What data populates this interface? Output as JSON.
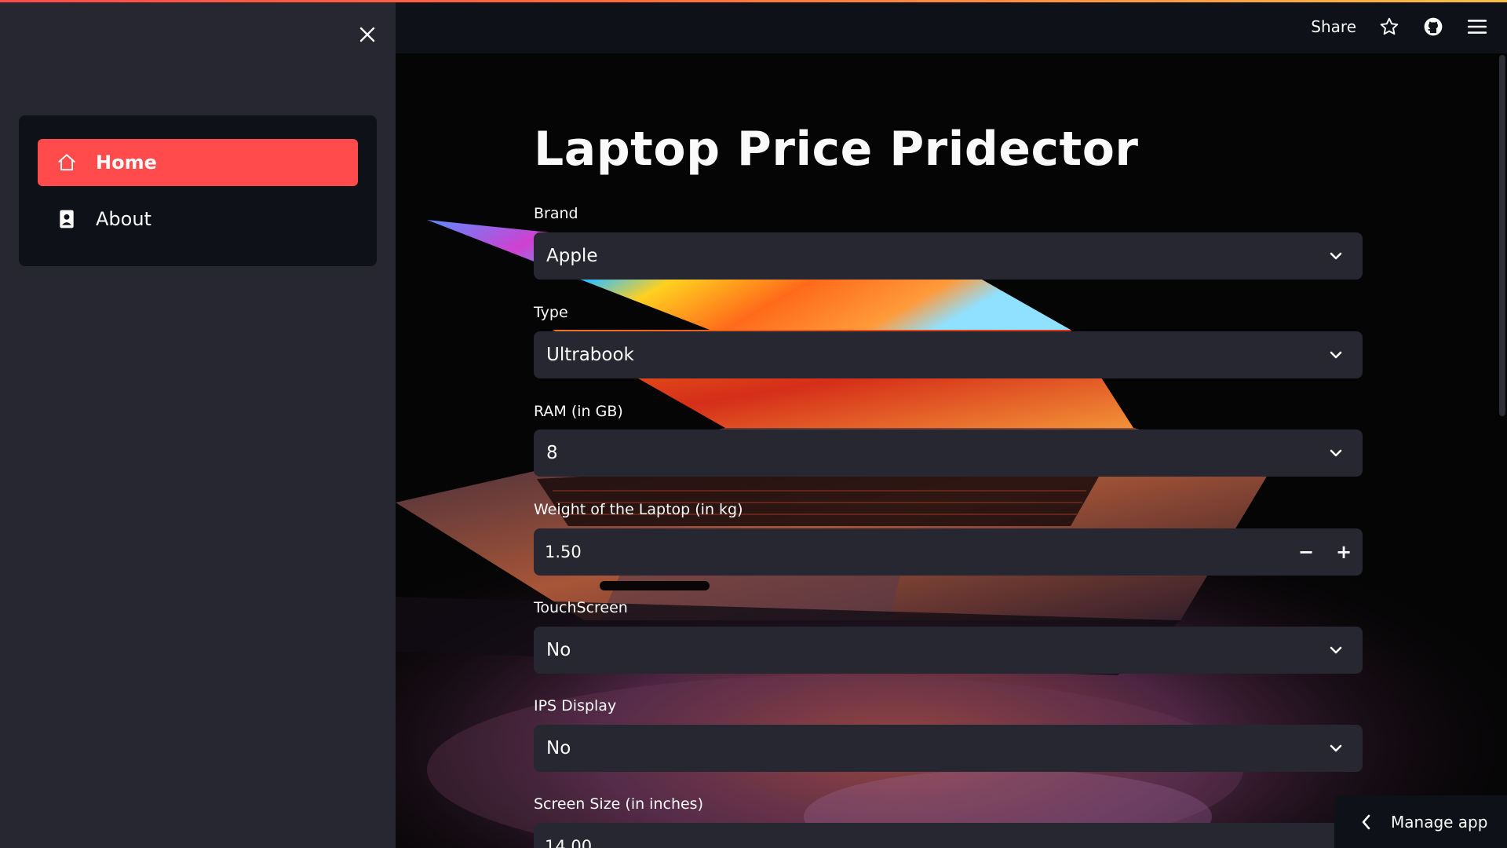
{
  "colors": {
    "accent": "#ff4b4b",
    "sidebar_bg": "#262730",
    "panel_bg": "#0e1117",
    "input_bg": "#262730",
    "text": "#fafafa"
  },
  "sidebar": {
    "close_icon": "close-icon",
    "nav": [
      {
        "label": "Home",
        "icon": "house-icon",
        "active": true
      },
      {
        "label": "About",
        "icon": "contact-card-icon",
        "active": false
      }
    ]
  },
  "header": {
    "share_label": "Share",
    "icons": [
      "star-icon",
      "github-icon",
      "hamburger-menu-icon"
    ]
  },
  "main": {
    "title": "Laptop Price Pridector",
    "fields": {
      "brand": {
        "label": "Brand",
        "value": "Apple"
      },
      "type": {
        "label": "Type",
        "value": "Ultrabook"
      },
      "ram": {
        "label": "RAM (in GB)",
        "value": "8"
      },
      "weight": {
        "label": "Weight of the Laptop (in kg)",
        "value": "1.50"
      },
      "touchscreen": {
        "label": "TouchScreen",
        "value": "No"
      },
      "ips": {
        "label": "IPS Display",
        "value": "No"
      },
      "screen_size": {
        "label": "Screen Size (in inches)",
        "value": "14.00"
      }
    },
    "stepper": {
      "decrement": "−",
      "increment": "+"
    }
  },
  "footer": {
    "manage_app_label": "Manage app"
  }
}
